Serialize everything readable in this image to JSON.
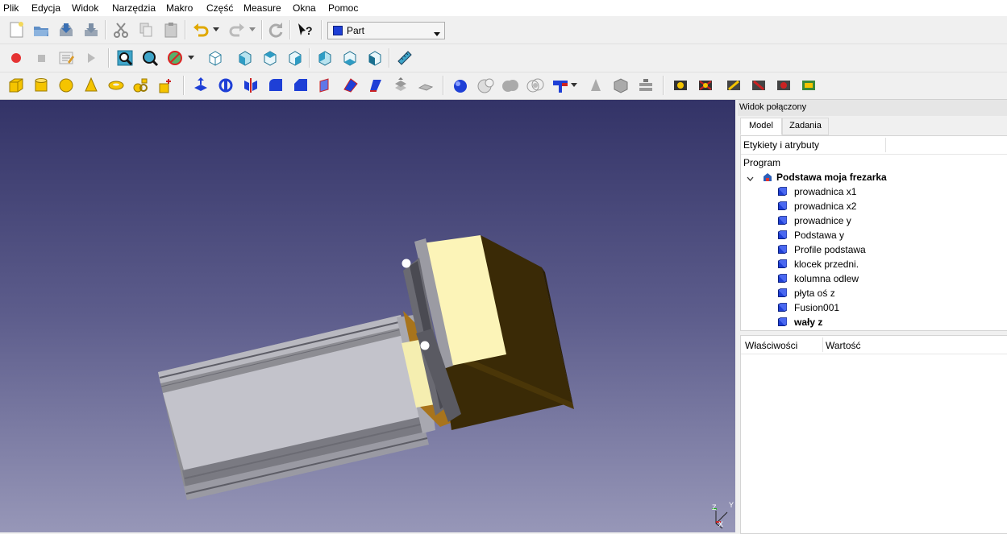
{
  "menu": [
    "Plik",
    "Edycja",
    "Widok",
    "Narzędzia",
    "Makro",
    "Część",
    "Measure",
    "Okna",
    "Pomoc"
  ],
  "workbench": {
    "selected": "Part"
  },
  "toolbar_icons": {
    "row1": [
      "new-file-icon",
      "open-file-icon",
      "save-icon",
      "save-as-icon",
      "cut-icon",
      "copy-icon",
      "paste-icon",
      "undo-icon",
      "redo-icon",
      "refresh-icon",
      "whats-this-icon"
    ],
    "row2": [
      "record-macro-icon",
      "stop-macro-icon",
      "edit-macro-icon",
      "run-macro-icon",
      "fit-all-icon",
      "fit-selection-icon",
      "draw-style-icon",
      "isometric-view-icon",
      "front-view-icon",
      "top-view-icon",
      "right-view-icon",
      "rear-view-icon",
      "bottom-view-icon",
      "left-view-icon",
      "measure-icon"
    ],
    "row3": [
      "box-icon",
      "cylinder-icon",
      "sphere-icon",
      "cone-icon",
      "torus-icon",
      "primitives-icon",
      "shape-builder-icon",
      "extrude-icon",
      "revolve-icon",
      "mirror-icon",
      "fillet-icon",
      "chamfer-icon",
      "face-from-edges-icon",
      "ruled-surface-icon",
      "loft-icon",
      "sweep-icon",
      "section-icon",
      "cross-sections-icon",
      "boolean-icon",
      "cut-icon",
      "union-icon",
      "intersection-icon",
      "join-features-icon",
      "split-icon",
      "compound-icon",
      "check-geometry-icon",
      "defeaturing-icon",
      "thickness-icon",
      "offset-icon",
      "measure-linear-icon",
      "measure-angular-icon",
      "measure-refresh-icon",
      "measure-clear-icon",
      "measure-toggle-3d-icon"
    ]
  },
  "panel": {
    "title": "Widok połączony",
    "tabs": [
      "Model",
      "Zadania"
    ],
    "active_tab": "Model",
    "tree_header": "Etykiety i atrybuty",
    "program_label": "Program",
    "document": "Podstawa moja frezarka",
    "items": [
      {
        "label": "prowadnica x1",
        "bold": false
      },
      {
        "label": "prowadnica x2",
        "bold": false
      },
      {
        "label": "prowadnice y",
        "bold": false
      },
      {
        "label": "Podstawa y",
        "bold": false
      },
      {
        "label": "Profile podstawa",
        "bold": false
      },
      {
        "label": "klocek przedni.",
        "bold": false
      },
      {
        "label": "kolumna odlew",
        "bold": false
      },
      {
        "label": "płyta oś z",
        "bold": false
      },
      {
        "label": "Fusion001",
        "bold": false
      },
      {
        "label": "wały z",
        "bold": true
      }
    ],
    "props_headers": [
      "Właściwości",
      "Wartość"
    ]
  },
  "axis": {
    "z": "Z",
    "y": "Y",
    "x": "X"
  },
  "colors": {
    "viewport_top": "#333367",
    "viewport_bottom": "#9797b8",
    "part_icon": "#1e3fd6"
  }
}
